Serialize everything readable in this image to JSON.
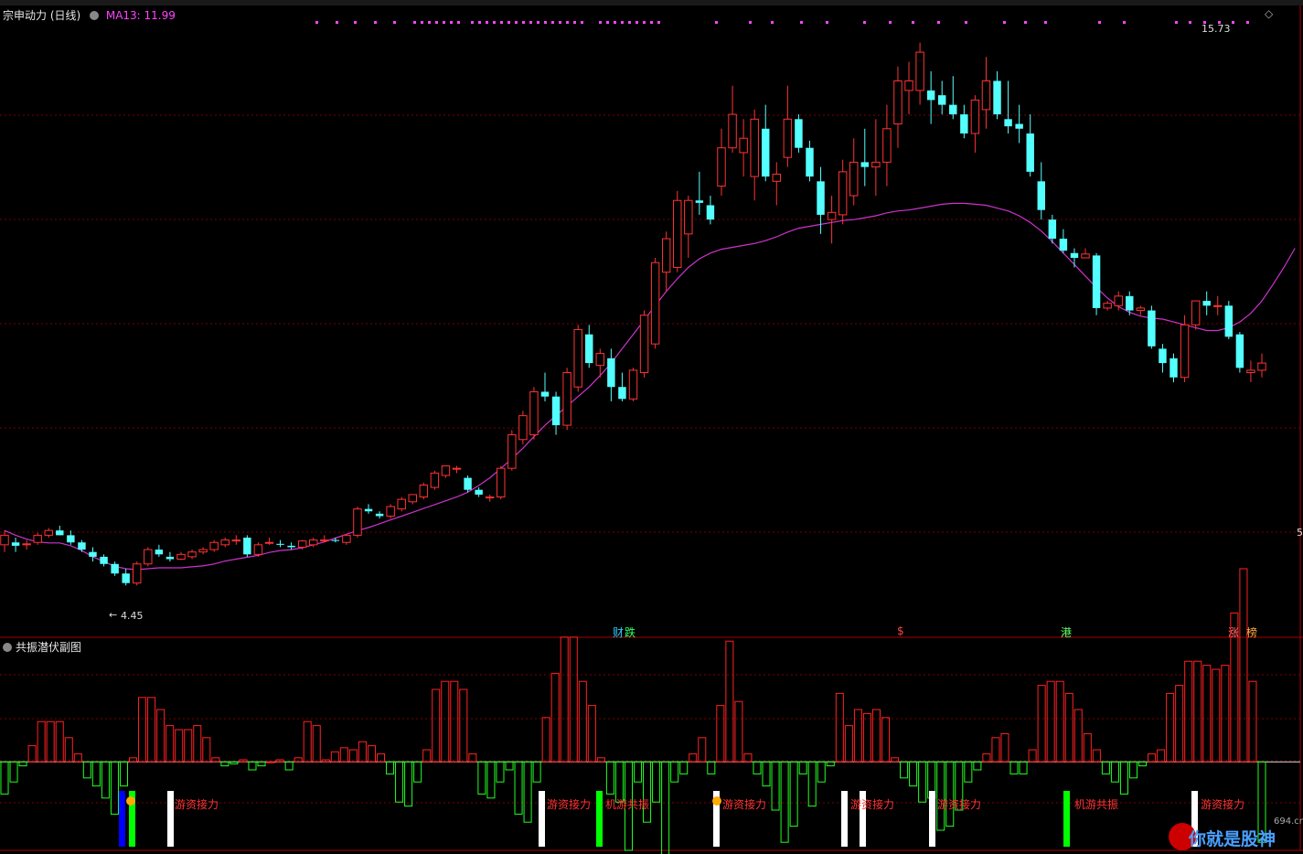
{
  "main_panel": {
    "title": "宗申动力 (日线)",
    "ma_label": "MA13: 11.99",
    "high_label": "15.73",
    "low_label": "4.45",
    "right_edge_label": "5"
  },
  "sub_panel": {
    "title": "共振潜伏副图"
  },
  "event_tags": [
    {
      "text": "财",
      "color": "#33ccff"
    },
    {
      "text": "跌",
      "color": "#33ff66"
    },
    {
      "text": "$",
      "color": "#ff4444"
    },
    {
      "text": "港",
      "color": "#66ff66"
    },
    {
      "text": "涨",
      "color": "#ff6666"
    },
    {
      "text": "榜",
      "color": "#ffaa44"
    }
  ],
  "signal_labels": [
    "游资接力",
    "游资接力",
    "机游共振",
    "游资接力",
    "游资接力",
    "游资接力",
    "机游共振",
    "游资接力"
  ],
  "watermark": {
    "site": "694.cn",
    "text": "你就是股神"
  },
  "colors": {
    "up": "#ff3333",
    "down": "#54ffff",
    "ma": "#cc33cc",
    "grid": "#7a0000"
  },
  "chart_data": [
    {
      "type": "candlestick",
      "title": "宗申动力 (日线)",
      "ylim": [
        3.5,
        16.5
      ],
      "series": [
        {
          "name": "MA13",
          "values": [
            5.6,
            5.5,
            5.42,
            5.36,
            5.34,
            5.34,
            5.28,
            5.18,
            5.05,
            4.95,
            4.85,
            4.8,
            4.78,
            4.8,
            4.82,
            4.82,
            4.82,
            4.84,
            4.86,
            4.9,
            4.96,
            5.0,
            5.04,
            5.08,
            5.14,
            5.18,
            5.2,
            5.24,
            5.3,
            5.36,
            5.44,
            5.52,
            5.6,
            5.66,
            5.74,
            5.82,
            5.9,
            5.98,
            6.06,
            6.14,
            6.22,
            6.3,
            6.4,
            6.54,
            6.7,
            6.9,
            7.1,
            7.32,
            7.56,
            7.8,
            8.0,
            8.2,
            8.4,
            8.6,
            8.84,
            9.1,
            9.4,
            9.7,
            10.0,
            10.3,
            10.6,
            10.86,
            11.1,
            11.28,
            11.4,
            11.48,
            11.52,
            11.56,
            11.6,
            11.66,
            11.74,
            11.84,
            11.92,
            11.96,
            12.0,
            12.04,
            12.08,
            12.1,
            12.14,
            12.18,
            12.24,
            12.28,
            12.3,
            12.34,
            12.38,
            12.42,
            12.44,
            12.44,
            12.42,
            12.4,
            12.34,
            12.28,
            12.18,
            12.04,
            11.86,
            11.64,
            11.4,
            11.16,
            10.92,
            10.68,
            10.46,
            10.28,
            10.16,
            10.08,
            10.04,
            10.02,
            9.96,
            9.9,
            9.84,
            9.78,
            9.78,
            9.84,
            9.96,
            10.14,
            10.4,
            10.74,
            11.1,
            11.5
          ]
        },
        {
          "name": "OHLC",
          "values": [
            [
              5.3,
              5.6,
              5.15,
              5.5
            ],
            [
              5.35,
              5.45,
              5.15,
              5.28
            ],
            [
              5.3,
              5.4,
              5.2,
              5.32
            ],
            [
              5.35,
              5.55,
              5.3,
              5.5
            ],
            [
              5.5,
              5.65,
              5.45,
              5.6
            ],
            [
              5.6,
              5.7,
              5.5,
              5.5
            ],
            [
              5.5,
              5.6,
              5.3,
              5.35
            ],
            [
              5.35,
              5.4,
              5.15,
              5.2
            ],
            [
              5.15,
              5.25,
              4.95,
              5.05
            ],
            [
              5.05,
              5.1,
              4.85,
              4.9
            ],
            [
              4.9,
              4.95,
              4.65,
              4.7
            ],
            [
              4.7,
              4.8,
              4.45,
              4.5
            ],
            [
              4.5,
              4.95,
              4.45,
              4.9
            ],
            [
              4.9,
              5.25,
              4.85,
              5.2
            ],
            [
              5.2,
              5.3,
              5.05,
              5.1
            ],
            [
              5.05,
              5.15,
              4.95,
              5.0
            ],
            [
              5.0,
              5.15,
              4.98,
              5.1
            ],
            [
              5.05,
              5.2,
              5.0,
              5.15
            ],
            [
              5.15,
              5.25,
              5.1,
              5.2
            ],
            [
              5.2,
              5.4,
              5.15,
              5.35
            ],
            [
              5.3,
              5.45,
              5.25,
              5.4
            ],
            [
              5.4,
              5.5,
              5.3,
              5.4
            ],
            [
              5.45,
              5.5,
              5.05,
              5.1
            ],
            [
              5.1,
              5.35,
              5.05,
              5.3
            ],
            [
              5.35,
              5.45,
              5.3,
              5.35
            ],
            [
              5.32,
              5.4,
              5.25,
              5.3
            ],
            [
              5.28,
              5.35,
              5.2,
              5.25
            ],
            [
              5.25,
              5.4,
              5.2,
              5.38
            ],
            [
              5.3,
              5.45,
              5.25,
              5.4
            ],
            [
              5.4,
              5.5,
              5.35,
              5.4
            ],
            [
              5.4,
              5.45,
              5.35,
              5.38
            ],
            [
              5.35,
              5.5,
              5.3,
              5.5
            ],
            [
              5.5,
              6.1,
              5.45,
              6.05
            ],
            [
              6.05,
              6.15,
              5.95,
              6.0
            ],
            [
              5.95,
              6.0,
              5.85,
              5.9
            ],
            [
              5.9,
              6.15,
              5.85,
              6.1
            ],
            [
              6.05,
              6.3,
              6.0,
              6.25
            ],
            [
              6.2,
              6.35,
              6.15,
              6.35
            ],
            [
              6.3,
              6.6,
              6.25,
              6.55
            ],
            [
              6.5,
              6.85,
              6.45,
              6.8
            ],
            [
              6.75,
              6.95,
              6.7,
              6.95
            ],
            [
              6.9,
              6.95,
              6.8,
              6.9
            ],
            [
              6.7,
              6.75,
              6.4,
              6.45
            ],
            [
              6.45,
              6.5,
              6.3,
              6.35
            ],
            [
              6.3,
              6.35,
              6.2,
              6.3
            ],
            [
              6.3,
              6.95,
              6.25,
              6.9
            ],
            [
              6.9,
              7.7,
              6.85,
              7.6
            ],
            [
              7.5,
              8.1,
              7.4,
              8.0
            ],
            [
              7.6,
              8.6,
              7.5,
              8.5
            ],
            [
              8.5,
              8.9,
              8.3,
              8.4
            ],
            [
              8.4,
              8.5,
              7.6,
              7.8
            ],
            [
              7.8,
              9.0,
              7.7,
              8.9
            ],
            [
              8.6,
              9.9,
              8.5,
              9.8
            ],
            [
              9.7,
              9.9,
              9.0,
              9.1
            ],
            [
              9.05,
              9.4,
              8.8,
              9.3
            ],
            [
              9.2,
              9.4,
              8.3,
              8.6
            ],
            [
              8.6,
              8.9,
              8.3,
              8.35
            ],
            [
              8.35,
              9.0,
              8.3,
              8.95
            ],
            [
              8.9,
              10.2,
              8.8,
              10.1
            ],
            [
              9.5,
              11.3,
              9.4,
              11.2
            ],
            [
              11.0,
              11.85,
              10.6,
              11.7
            ],
            [
              11.1,
              12.7,
              11.0,
              12.5
            ],
            [
              11.8,
              12.6,
              11.3,
              12.5
            ],
            [
              12.5,
              13.1,
              12.2,
              12.45
            ],
            [
              12.4,
              12.6,
              12.0,
              12.1
            ],
            [
              12.8,
              14.0,
              12.6,
              13.6
            ],
            [
              13.6,
              14.9,
              13.5,
              14.3
            ],
            [
              13.5,
              14.2,
              13.0,
              13.8
            ],
            [
              13.0,
              14.4,
              12.5,
              14.2
            ],
            [
              14.0,
              14.5,
              12.9,
              13.0
            ],
            [
              12.9,
              13.3,
              12.4,
              13.05
            ],
            [
              13.4,
              14.9,
              13.2,
              14.2
            ],
            [
              14.2,
              14.3,
              13.5,
              13.6
            ],
            [
              13.6,
              13.75,
              12.9,
              13.0
            ],
            [
              12.9,
              13.2,
              11.8,
              12.2
            ],
            [
              12.1,
              12.6,
              11.6,
              12.25
            ],
            [
              12.2,
              13.35,
              12.0,
              13.1
            ],
            [
              12.6,
              13.8,
              12.4,
              13.3
            ],
            [
              13.3,
              14.0,
              12.8,
              13.2
            ],
            [
              13.2,
              14.2,
              12.6,
              13.3
            ],
            [
              13.3,
              14.5,
              12.8,
              14.0
            ],
            [
              14.1,
              15.3,
              13.6,
              15.0
            ],
            [
              14.8,
              15.4,
              14.3,
              15.0
            ],
            [
              14.8,
              15.8,
              14.5,
              15.6
            ],
            [
              14.8,
              15.2,
              14.1,
              14.6
            ],
            [
              14.7,
              15.0,
              14.3,
              14.5
            ],
            [
              14.5,
              15.1,
              14.2,
              14.3
            ],
            [
              14.3,
              14.5,
              13.8,
              13.9
            ],
            [
              13.9,
              14.7,
              13.5,
              14.6
            ],
            [
              14.4,
              15.5,
              14.0,
              15.0
            ],
            [
              15.0,
              15.2,
              14.2,
              14.3
            ],
            [
              14.2,
              15.0,
              13.9,
              14.05
            ],
            [
              14.1,
              14.5,
              13.7,
              14.0
            ],
            [
              13.9,
              14.3,
              13.0,
              13.1
            ],
            [
              12.9,
              13.3,
              12.1,
              12.3
            ],
            [
              12.1,
              12.2,
              11.6,
              11.7
            ],
            [
              11.7,
              11.9,
              11.4,
              11.45
            ],
            [
              11.4,
              11.5,
              11.1,
              11.3
            ],
            [
              11.3,
              11.5,
              11.3,
              11.38
            ],
            [
              11.35,
              11.4,
              10.1,
              10.25
            ],
            [
              10.25,
              10.4,
              10.2,
              10.35
            ],
            [
              10.3,
              10.6,
              10.2,
              10.5
            ],
            [
              10.5,
              10.6,
              10.1,
              10.2
            ],
            [
              10.2,
              10.3,
              10.1,
              10.25
            ],
            [
              10.2,
              10.3,
              9.4,
              9.45
            ],
            [
              9.4,
              9.5,
              8.9,
              9.1
            ],
            [
              9.2,
              9.3,
              8.7,
              8.8
            ],
            [
              8.8,
              10.1,
              8.7,
              9.9
            ],
            [
              9.9,
              10.4,
              9.8,
              10.4
            ],
            [
              10.4,
              10.6,
              10.1,
              10.3
            ],
            [
              10.3,
              10.5,
              10.1,
              10.3
            ],
            [
              10.3,
              10.4,
              9.6,
              9.65
            ],
            [
              9.7,
              9.75,
              8.9,
              9.0
            ],
            [
              8.9,
              9.15,
              8.7,
              8.95
            ],
            [
              8.95,
              9.3,
              8.8,
              9.1
            ]
          ]
        }
      ]
    },
    {
      "type": "bar",
      "title": "共振潜伏副图",
      "ylim": [
        -2.2,
        2.8
      ],
      "series": [
        {
          "name": "histogram",
          "values": [
            -0.8,
            -0.5,
            -0.1,
            0.4,
            1.0,
            1.0,
            1.0,
            0.6,
            0.2,
            -0.4,
            -0.6,
            -0.9,
            -1.3,
            -0.6,
            0.1,
            1.6,
            1.6,
            1.3,
            0.9,
            0.8,
            0.8,
            0.9,
            0.6,
            0.1,
            -0.1,
            -0.05,
            0.05,
            -0.2,
            -0.1,
            0.0,
            0.05,
            -0.2,
            0.1,
            1.0,
            0.9,
            0.05,
            0.25,
            0.35,
            0.3,
            0.5,
            0.4,
            0.2,
            -0.3,
            -1.0,
            -1.1,
            -0.5,
            0.3,
            1.8,
            2.0,
            2.0,
            1.8,
            0.2,
            -0.8,
            -0.9,
            -0.5,
            -0.2,
            -1.3,
            -1.5,
            -0.5,
            1.1,
            2.2,
            3.1,
            3.1,
            2.0,
            1.4,
            0.1,
            -0.8,
            -1.0,
            -2.2,
            -0.5,
            -1.5,
            -1.0,
            -2.4,
            -0.5,
            -0.3,
            0.2,
            0.6,
            -0.3,
            1.4,
            3.0,
            1.5,
            0.2,
            -0.3,
            -0.6,
            -1.2,
            -2.0,
            -1.6,
            -0.3,
            -1.1,
            -0.5,
            -0.1,
            1.7,
            0.9,
            1.3,
            1.2,
            1.3,
            1.1,
            0.1,
            -0.4,
            -0.6,
            -1.0,
            -0.9,
            -1.7,
            -1.6,
            -1.2,
            -0.5,
            -0.2,
            0.2,
            0.6,
            0.7,
            -0.3,
            -0.3,
            0.3,
            1.9,
            2.0,
            2.0,
            1.7,
            1.3,
            0.7,
            0.3,
            -0.3,
            -0.5,
            -0.8,
            -0.4,
            -0.1,
            0.2,
            0.3,
            1.7,
            1.9,
            2.5,
            2.5,
            2.4,
            2.3,
            2.4,
            3.7,
            4.8,
            2.0,
            -2.0
          ]
        }
      ]
    }
  ]
}
